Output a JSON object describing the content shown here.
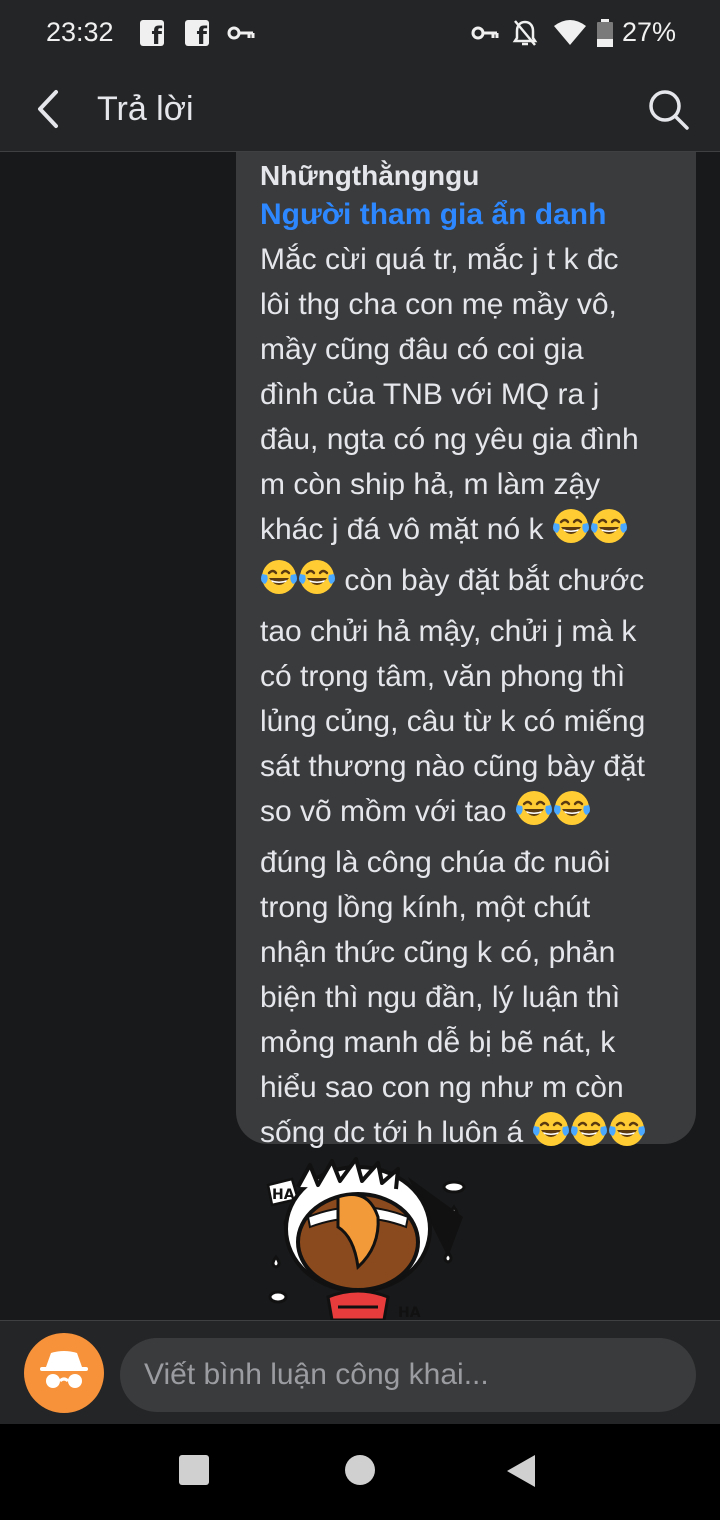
{
  "status_bar": {
    "time": "23:32",
    "battery": "27%",
    "icons": [
      "facebook-icon",
      "facebook-icon",
      "key-icon",
      "vpn-key-icon",
      "notifications-off-icon",
      "wifi-icon",
      "battery-icon"
    ]
  },
  "header": {
    "title": "Trả lời",
    "back_icon": "chevron-left-icon",
    "search_icon": "search-icon"
  },
  "comment": {
    "author": "Nhữngthằngngu",
    "badge": "Người tham gia ẩn danh",
    "lines": [
      "Mắc cừi quá tr, mắc j t k đc",
      "lôi thg cha con mẹ mầy vô,",
      "mầy cũng đâu có coi gia",
      "đình của TNB với MQ ra j",
      "đâu, ngta có ng yêu gia đình",
      "m còn ship hả, m làm zậy",
      "khác j đá vô mặt nó k",
      "còn bày đặt bắt chước",
      "tao chửi hả mậy, chửi j mà k",
      "có trọng tâm, văn phong thì",
      "lủng củng, câu từ k có miếng",
      "sát thương nào cũng bày đặt",
      "so võ mồm với tao",
      "đúng là công chúa đc nuôi",
      "trong lồng kính, một chút",
      "nhận thức cũng k có, phản",
      "biện thì ngu đần, lý luận thì",
      "mỏng manh dễ bị bẽ nát, k",
      "hiểu sao con ng như m còn",
      "sống dc tới h luôn á"
    ],
    "emoji_name": "face-with-tears-of-joy-icon"
  },
  "sticker": {
    "name": "laughing-cartoon-sticker"
  },
  "composer": {
    "placeholder": "Viết bình luận công khai...",
    "avatar_icon": "incognito-icon"
  },
  "nav": {
    "recents_icon": "square-icon",
    "home_icon": "circle-icon",
    "back_icon": "triangle-back-icon"
  },
  "colors": {
    "background": "#18191a",
    "bubble": "#3a3b3c",
    "header": "#242526",
    "badge_blue": "#2d88ff",
    "avatar_orange": "#f7923a"
  }
}
